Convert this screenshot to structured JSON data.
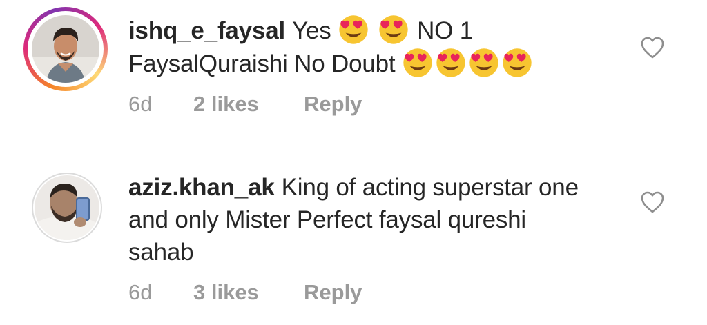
{
  "comments": [
    {
      "username": "ishq_e_faysal",
      "text_1": "Yes",
      "emoji_count_1": 2,
      "text_2": " NO 1",
      "text_3": "FaysalQuraishi No Doubt",
      "emoji_count_2": 4,
      "time": "6d",
      "likes": "2 likes",
      "reply": "Reply",
      "emoji": "heart-eyes-emoji",
      "avatar_ring": "story",
      "ring_colors": [
        "#f58529",
        "#dd2a7b",
        "#8134af",
        "#feda77"
      ]
    },
    {
      "username": "aziz.khan_ak",
      "text": "King of acting superstar one and only Mister Perfect faysal qureshi sahab",
      "time": "6d",
      "likes": "3 likes",
      "reply": "Reply",
      "avatar_ring": "none"
    }
  ],
  "icons": {
    "like": "heart-outline-icon"
  },
  "colors": {
    "text": "#262626",
    "meta": "#9a9a9a",
    "heart_stroke": "#8e8e8e"
  }
}
